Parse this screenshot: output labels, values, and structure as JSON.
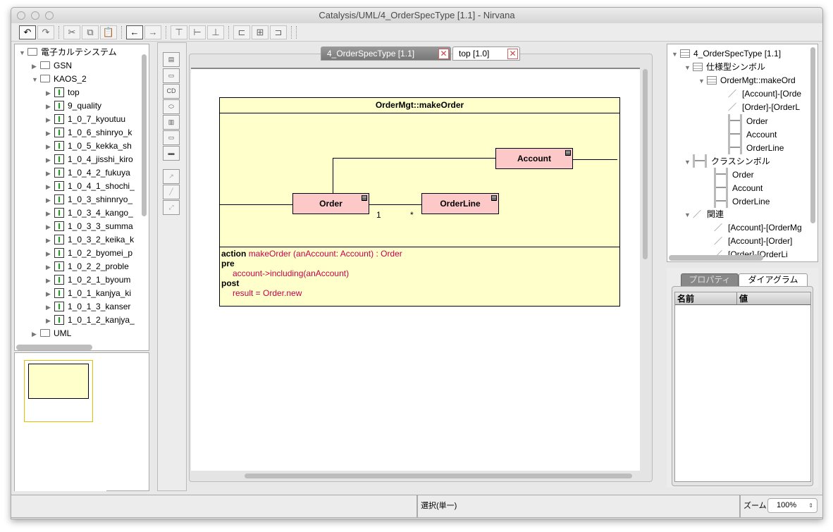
{
  "window": {
    "title": "Catalysis/UML/4_OrderSpecType [1.1]  - Nirvana"
  },
  "toolbar": {
    "buttons": [
      {
        "name": "undo",
        "icon": "↶"
      },
      {
        "name": "redo",
        "icon": "↷"
      },
      {
        "name": "cut",
        "icon": "✂"
      },
      {
        "name": "copy",
        "icon": "⧉"
      },
      {
        "name": "paste",
        "icon": "📋"
      },
      {
        "name": "back",
        "icon": "←"
      },
      {
        "name": "forward",
        "icon": "→"
      },
      {
        "name": "align-top",
        "icon": "⊤"
      },
      {
        "name": "align-middle",
        "icon": "⊢"
      },
      {
        "name": "align-bottom",
        "icon": "⊥"
      },
      {
        "name": "align-left",
        "icon": "⊏"
      },
      {
        "name": "align-center",
        "icon": "⊞"
      },
      {
        "name": "align-right",
        "icon": "⊐"
      }
    ]
  },
  "left_tree": {
    "root": "電子カルテシステム",
    "gsn": "GSN",
    "kaos": "KAOS_2",
    "kaos_items": [
      "top",
      "9_quality",
      "1_0_7_kyoutuu",
      "1_0_6_shinryo_k",
      "1_0_5_kekka_sh",
      "1_0_4_jisshi_kiro",
      "1_0_4_2_fukuya",
      "1_0_4_1_shochi_",
      "1_0_3_shinnryo_",
      "1_0_3_4_kango_",
      "1_0_3_3_summa",
      "1_0_3_2_keika_k",
      "1_0_2_byomei_p",
      "1_0_2_2_proble",
      "1_0_2_1_byoum",
      "1_0_1_kanjya_ki",
      "1_0_1_3_kanser",
      "1_0_1_2_kanjya_"
    ],
    "uml": "UML"
  },
  "tabs": [
    {
      "label": "4_OrderSpecType [1.1]",
      "active": true
    },
    {
      "label": "top [1.0]",
      "active": false
    }
  ],
  "diagram": {
    "frame_title": "OrderMgt::makeOrder",
    "classes": {
      "account": "Account",
      "order": "Order",
      "orderline": "OrderLine"
    },
    "multiplicity": {
      "order_end": "1",
      "orderline_end": "*"
    },
    "spec": {
      "action_kw": "action",
      "action_sig": "makeOrder (anAccount: Account) : Order",
      "pre_kw": "pre",
      "pre_expr": "account->including(anAccount)",
      "post_kw": "post",
      "post_expr": "result = Order.new"
    },
    "colors": {
      "frame": "#ffffcc",
      "class": "#fcc8c8",
      "expr": "#c8004a"
    }
  },
  "right_tree": {
    "root": "4_OrderSpecType [1.1]",
    "spec_symbols": "仕様型シンボル",
    "spec_item": "OrderMgt::makeOrd",
    "spec_assocs": [
      "[Account]-[Orde",
      "[Order]-[OrderL"
    ],
    "spec_classes": [
      "Order",
      "Account",
      "OrderLine"
    ],
    "class_symbols": "クラスシンボル",
    "classes": [
      "Order",
      "Account",
      "OrderLine"
    ],
    "relations": "関連",
    "relation_items": [
      "[Account]-[OrderMg",
      "[Account]-[Order]",
      "[Order]-[OrderLi"
    ]
  },
  "properties": {
    "tabs": [
      "プロパティ",
      "ダイアグラム"
    ],
    "columns": [
      "名前",
      "値"
    ]
  },
  "status": {
    "mode": "選択(単一)",
    "zoom_label": "ズーム",
    "zoom_value": "100%"
  }
}
